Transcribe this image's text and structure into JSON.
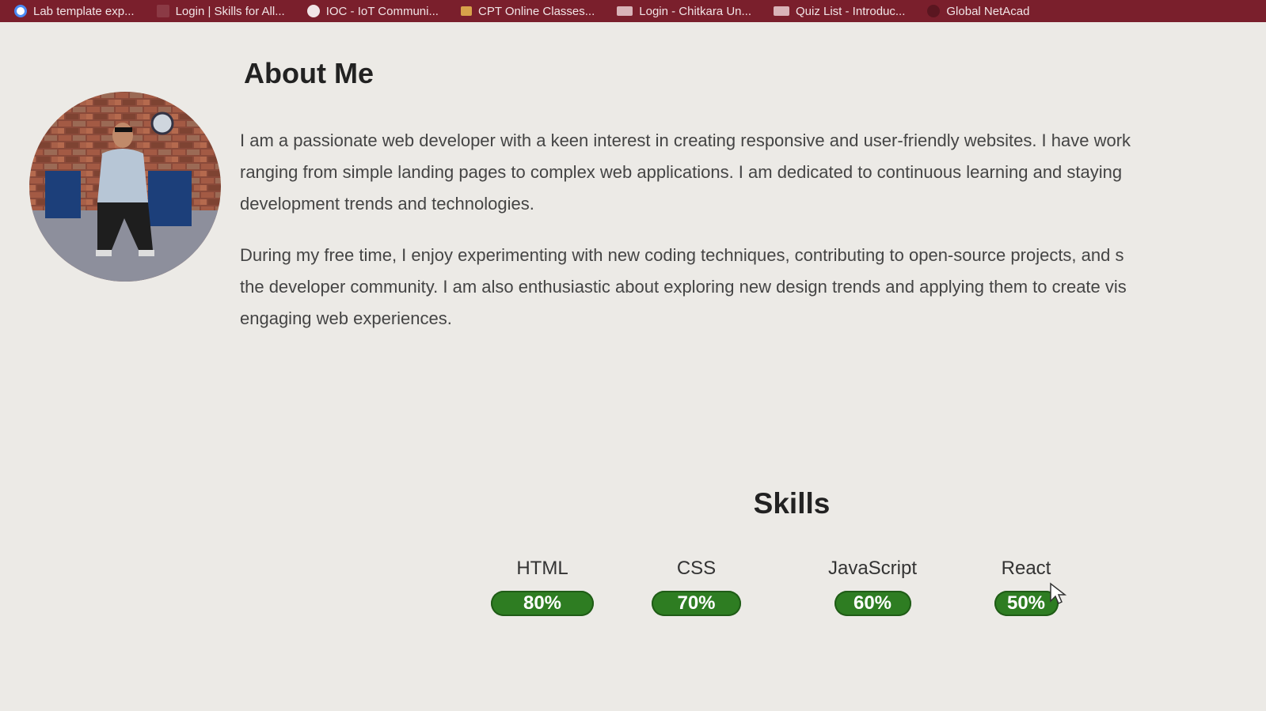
{
  "bookmarks": [
    {
      "label": "Lab template exp...",
      "icon": "google-icon"
    },
    {
      "label": "Login | Skills for All...",
      "icon": "skills-icon"
    },
    {
      "label": "IOC - IoT Communi...",
      "icon": "globe-icon"
    },
    {
      "label": "CPT Online Classes...",
      "icon": "folder-icon"
    },
    {
      "label": "Login - Chitkara Un...",
      "icon": "dtl-icon"
    },
    {
      "label": "Quiz List - Introduc...",
      "icon": "dtl-icon"
    },
    {
      "label": "Global NetAcad",
      "icon": "netacad-icon"
    }
  ],
  "about": {
    "title": "About Me",
    "paragraph1": [
      "I am a passionate web developer with a keen interest in creating responsive and user-friendly websites. I have work",
      "ranging from simple landing pages to complex web applications. I am dedicated to continuous learning and staying",
      "development trends and technologies."
    ],
    "paragraph2": [
      "During my free time, I enjoy experimenting with new coding techniques, contributing to open-source projects, and s",
      "the developer community. I am also enthusiastic about exploring new design trends and applying them to create vis",
      "engaging web experiences."
    ]
  },
  "skills": {
    "title": "Skills",
    "items": [
      {
        "name": "HTML",
        "label": "80%",
        "percent": 80
      },
      {
        "name": "CSS",
        "label": "70%",
        "percent": 70
      },
      {
        "name": "JavaScript",
        "label": "60%",
        "percent": 60
      },
      {
        "name": "React",
        "label": "50%",
        "percent": 50
      }
    ]
  },
  "colors": {
    "bookmark_bar": "#7a1f2c",
    "skill_fill": "#2e7d22",
    "page_bg": "#eceae6"
  }
}
